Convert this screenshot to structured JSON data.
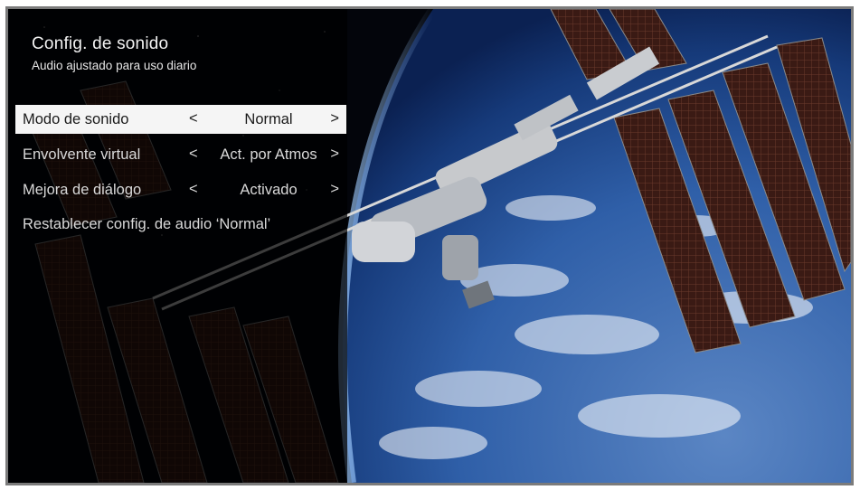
{
  "settings": {
    "title": "Config. de sonido",
    "subtitle": "Audio ajustado para uso diario",
    "items": [
      {
        "label": "Modo de sonido",
        "value": "Normal",
        "prev": "<",
        "next": ">",
        "selected": true
      },
      {
        "label": "Envolvente virtual",
        "value": "Act. por Atmos",
        "prev": "<",
        "next": ">",
        "selected": false
      },
      {
        "label": "Mejora de diálogo",
        "value": "Activado",
        "prev": "<",
        "next": ">",
        "selected": false
      }
    ],
    "reset_label": "Restablecer config. de audio ‘Normal’"
  },
  "colors": {
    "frame": "#7b7b7b",
    "selected_row_bg": "#f5f5f5",
    "panel_overlay": "rgba(0,0,0,0.72)"
  }
}
